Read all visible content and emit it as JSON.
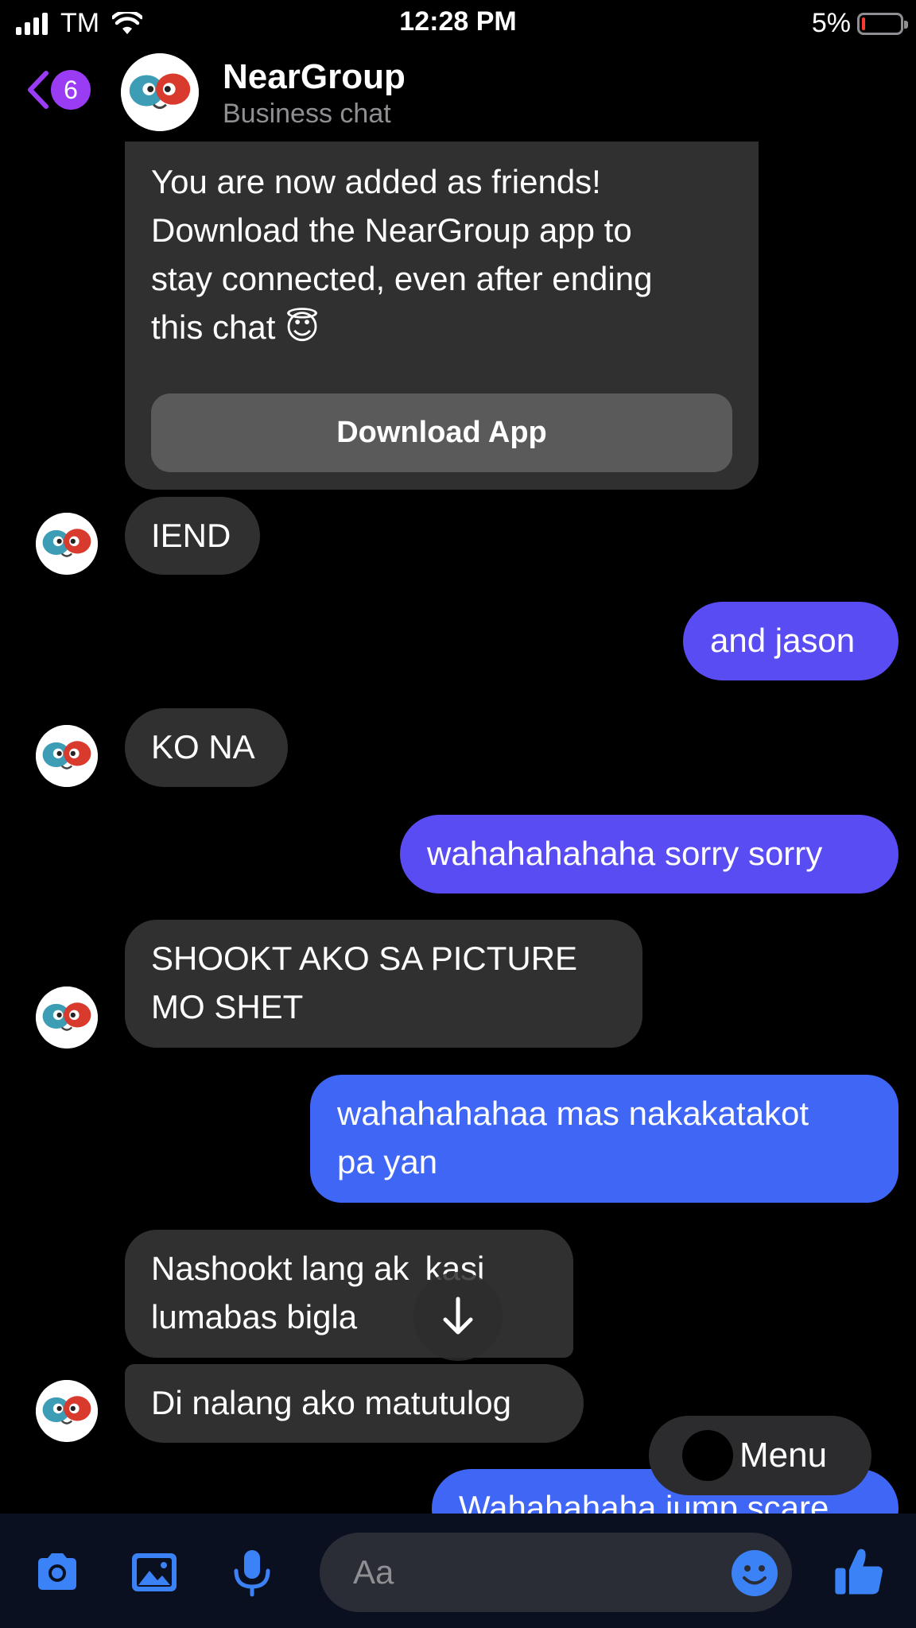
{
  "status_bar": {
    "carrier": "TM",
    "time": "12:28 PM",
    "battery_percent": "5%",
    "battery_level": 0.05,
    "icons": [
      "signal-icon",
      "wifi-icon",
      "battery-icon"
    ]
  },
  "header": {
    "back_badge": "6",
    "title": "NearGroup",
    "subtitle": "Business chat",
    "icons": [
      "back-chevron-icon",
      "neargroup-avatar"
    ]
  },
  "card": {
    "lines": [
      "You are now added as friends!",
      "Download the NearGroup app to",
      "stay connected, even after ending",
      "this chat 😇"
    ],
    "button_label": "Download App"
  },
  "messages": [
    {
      "side": "in",
      "text": "IEND"
    },
    {
      "side": "out",
      "text": "and jason"
    },
    {
      "side": "in",
      "text": "KO NA"
    },
    {
      "side": "out",
      "text": "wahahahahaha sorry sorry"
    },
    {
      "side": "in",
      "lines": [
        "SHOOKT AKO SA PICTURE",
        "MO SHET"
      ]
    },
    {
      "side": "out",
      "lines": [
        "wahahahahaa mas nakakatakot",
        "pa yan"
      ]
    },
    {
      "side": "in",
      "lines": [
        "Nashookt lang ak  kasi",
        "lumabas bigla"
      ]
    },
    {
      "side": "in",
      "text": "Di nalang ako matutulog"
    },
    {
      "side": "out",
      "text": "Wahahahaha jump scare"
    }
  ],
  "floating": {
    "menu_label": "Menu",
    "scroll_icon": "arrow-down-icon"
  },
  "composer": {
    "placeholder": "Aa",
    "icons": [
      "camera-icon",
      "photo-icon",
      "microphone-icon",
      "emoji-icon",
      "thumbs-up-icon"
    ],
    "accent": "#3b82f6"
  },
  "colors": {
    "incoming_bubble": "#303030",
    "outgoing_purple": "#5a4cf3",
    "outgoing_blue": "#3f66f5",
    "badge": "#9b3cf5"
  }
}
